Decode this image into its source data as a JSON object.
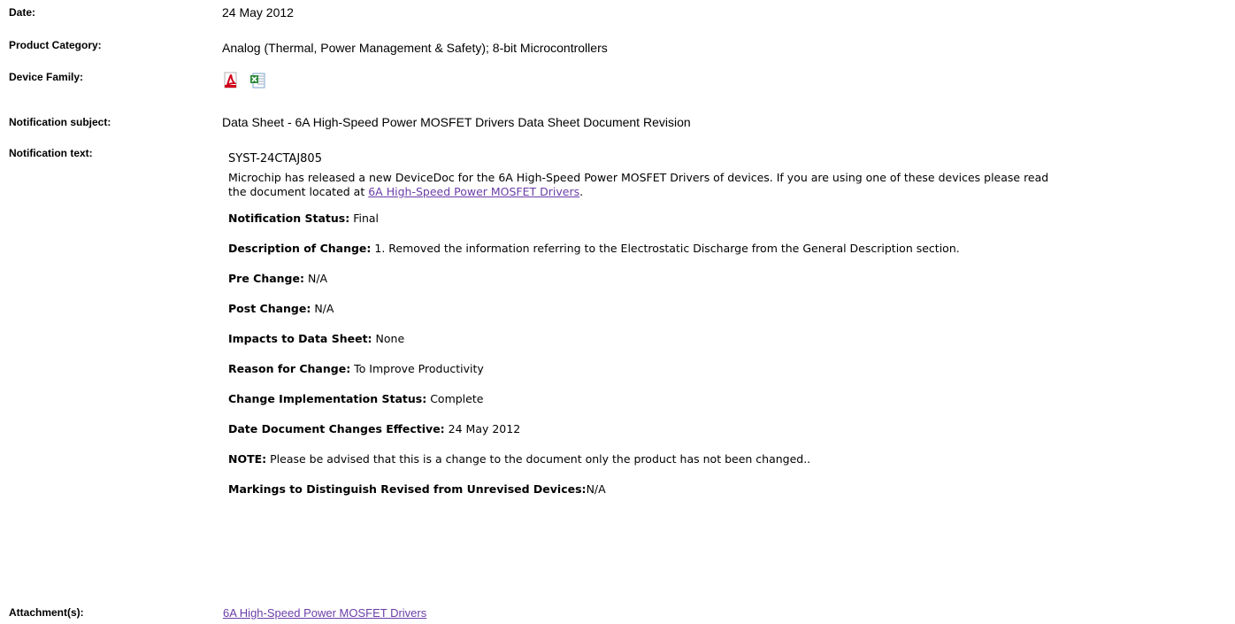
{
  "fields": {
    "date": {
      "label": "Date:",
      "value": "24 May 2012"
    },
    "product_category": {
      "label": "Product Category:",
      "value": "Analog (Thermal, Power Management & Safety); 8-bit Microcontrollers"
    },
    "device_family": {
      "label": "Device Family:",
      "icons": [
        "pdf-file-icon",
        "excel-file-icon"
      ]
    },
    "notification_subject": {
      "label": "Notification subject:",
      "value": "Data Sheet - 6A High-Speed Power MOSFET Drivers Data Sheet Document Revision"
    },
    "notification_text": {
      "label": "Notification text:"
    },
    "attachments": {
      "label": "Attachment(s):",
      "link": "6A High-Speed Power MOSFET Drivers"
    }
  },
  "notification": {
    "id": "SYST-24CTAJ805",
    "intro_part1": "Microchip has released a new DeviceDoc for the 6A High-Speed Power MOSFET Drivers of devices. If you are using one of these devices please read",
    "intro_part2": "the document located at",
    "intro_link": "6A High-Speed Power MOSFET Drivers",
    "intro_end": ".",
    "items": [
      {
        "label": "Notification Status:",
        "value": " Final"
      },
      {
        "label": "Description of Change:",
        "value": " 1. Removed the information referring to the Electrostatic Discharge from the General Description section."
      },
      {
        "label": "Pre Change:",
        "value": " N/A"
      },
      {
        "label": "Post Change:",
        "value": " N/A"
      },
      {
        "label": "Impacts to Data Sheet:",
        "value": " None"
      },
      {
        "label": "Reason for Change:",
        "value": " To Improve Productivity"
      },
      {
        "label": "Change Implementation Status:",
        "value": " Complete"
      },
      {
        "label": "Date Document Changes Effective:",
        "value": " 24 May 2012"
      },
      {
        "label": "NOTE:",
        "value": " Please be advised that this is a change to the document only the product has not been changed.."
      },
      {
        "label": "Markings to Distinguish Revised from Unrevised Devices:",
        "value": "N/A"
      }
    ]
  },
  "colors": {
    "link": "#6a3da8",
    "pdf_icon": "#d0021b",
    "excel_icon": "#2e8b3a"
  }
}
